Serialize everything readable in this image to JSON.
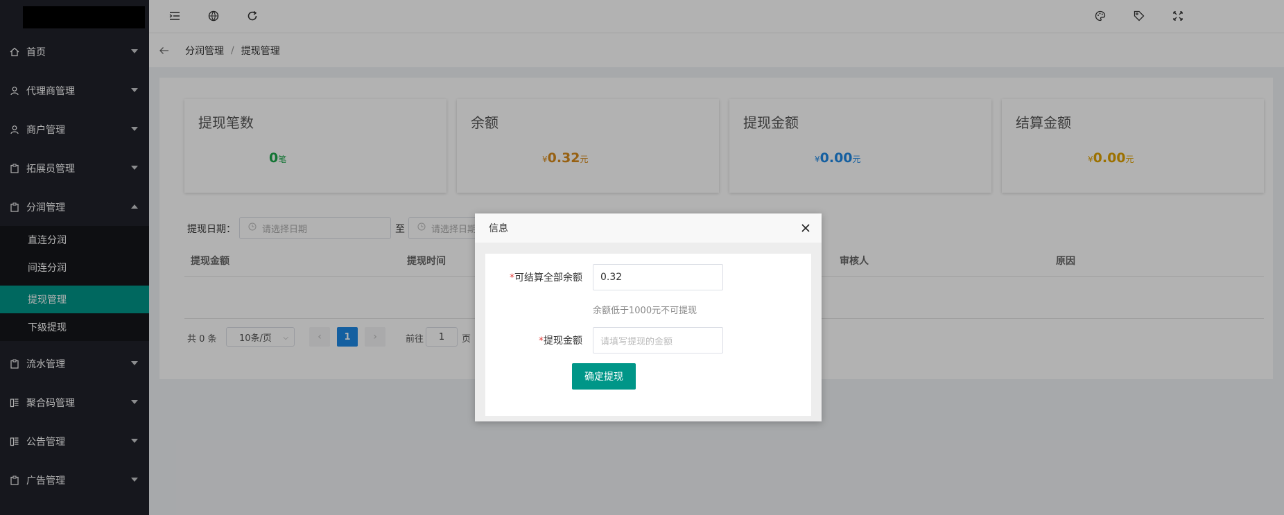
{
  "colors": {
    "sidebar_bg": "#20222a",
    "accent": "#009688",
    "primary": "#1e88e5",
    "green": "#1aa64a",
    "orange": "#d98c1c",
    "blue": "#1e88e5",
    "gold": "#e0a200"
  },
  "sidebar": {
    "menu": [
      {
        "label": "首页",
        "icon": "home-icon"
      },
      {
        "label": "代理商管理",
        "icon": "user-icon"
      },
      {
        "label": "商户管理",
        "icon": "user-icon"
      },
      {
        "label": "拓展员管理",
        "icon": "clipboard-icon"
      },
      {
        "label": "分润管理",
        "icon": "clipboard-icon",
        "expanded": true
      },
      {
        "label": "流水管理",
        "icon": "clipboard-icon"
      },
      {
        "label": "聚合码管理",
        "icon": "grid-icon"
      },
      {
        "label": "公告管理",
        "icon": "grid-icon"
      },
      {
        "label": "广告管理",
        "icon": "clipboard-icon"
      }
    ],
    "submenu": [
      {
        "label": "直连分润"
      },
      {
        "label": "间连分润"
      },
      {
        "label": "提现管理",
        "active": true
      },
      {
        "label": "下级提现"
      }
    ]
  },
  "topbar": {
    "icons": [
      "menu-collapse-icon",
      "globe-icon",
      "refresh-icon",
      "palette-icon",
      "tag-icon",
      "fullscreen-icon"
    ]
  },
  "breadcrumb": {
    "parent": "分润管理",
    "separator": "/",
    "current": "提现管理"
  },
  "stats": [
    {
      "title": "提现笔数",
      "prefix": "",
      "value": "0",
      "unit": "笔",
      "color": "#1aa64a"
    },
    {
      "title": "余额",
      "prefix": "¥",
      "value": "0.32",
      "unit": "元",
      "color": "#d98c1c"
    },
    {
      "title": "提现金额",
      "prefix": "¥",
      "value": "0.00",
      "unit": "元",
      "color": "#1e88e5"
    },
    {
      "title": "结算金额",
      "prefix": "¥",
      "value": "0.00",
      "unit": "元",
      "color": "#e0a200"
    }
  ],
  "filter": {
    "label": "提现日期：",
    "start_placeholder": "请选择日期",
    "to": "至",
    "end_placeholder": "请选择日期"
  },
  "table": {
    "columns": [
      "提现金额",
      "提现时间",
      "审核人",
      "原因"
    ]
  },
  "pagination": {
    "total_text": "共 0 条",
    "page_size": "10条/页",
    "current_page": "1",
    "goto_label": "前往",
    "goto_value": "1",
    "page_suffix": "页"
  },
  "dialog": {
    "title": "信息",
    "balance_label": "可结算全部余额",
    "balance_value": "0.32",
    "hint": "余额低于1000元不可提现",
    "amount_label": "提现金额",
    "amount_placeholder": "请填写提现的金额",
    "submit_label": "确定提现"
  }
}
